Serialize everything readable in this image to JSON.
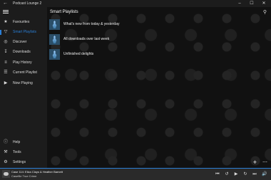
{
  "window": {
    "app_title": "Podcast Lounge 2",
    "back_icon": "back-arrow-icon",
    "controls": [
      "minimize-icon",
      "maximize-icon",
      "close-icon"
    ]
  },
  "sidebar": {
    "items": [
      {
        "label": "Favourites",
        "icon": "star-icon",
        "selected": false
      },
      {
        "label": "Smart Playlists",
        "icon": "funnel-icon",
        "selected": true
      },
      {
        "label": "Discover",
        "icon": "globe-icon",
        "selected": false
      },
      {
        "label": "Downloads",
        "icon": "download-icon",
        "selected": false
      },
      {
        "label": "Play History",
        "icon": "history-icon",
        "selected": false
      },
      {
        "label": "Current Playlist",
        "icon": "list-icon",
        "selected": false
      },
      {
        "label": "Now Playing",
        "icon": "play-icon",
        "selected": false
      },
      {
        "label": "Help",
        "icon": "info-icon",
        "selected": false
      },
      {
        "label": "Tools",
        "icon": "wrench-icon",
        "selected": false
      },
      {
        "label": "Settings",
        "icon": "gear-icon",
        "selected": false
      }
    ]
  },
  "main": {
    "title": "Smart Playlists",
    "playlists": [
      {
        "name": "What's new from today & yesterday"
      },
      {
        "name": "All downloads over last week"
      },
      {
        "name": "Unfinished delights"
      }
    ]
  },
  "player": {
    "episode": "Case 114: Eliza Clays & Heather Barnett",
    "podcast": "Casefile True Crime"
  },
  "colors": {
    "accent": "#2a7fd6",
    "sidebar_bg": "#1c1c1c",
    "player_bg": "#2a2a2a"
  }
}
